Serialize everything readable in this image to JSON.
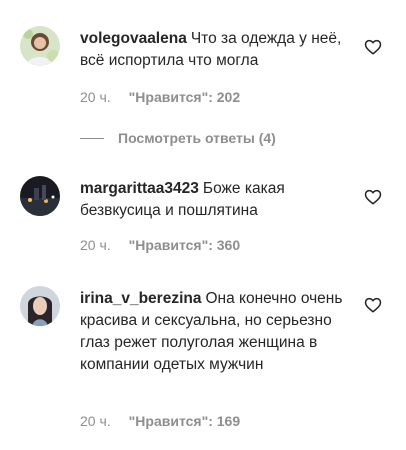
{
  "comments": [
    {
      "username": "volegovaalena",
      "text": "Что за одежда у неё, всё испортила что могла",
      "time": "20 ч.",
      "likes_label": "\"Нравится\": 202",
      "avatar_icon": "avatar-photo"
    },
    {
      "username": "margarittaa3423",
      "text": "Боже какая безвкусица и пошлятина",
      "time": "20 ч.",
      "likes_label": "\"Нравится\": 360",
      "avatar_icon": "avatar-photo"
    },
    {
      "username": "irina_v_berezina",
      "text": "Она конечно очень красива и сексуальна, но серьезно глаз режет полуголая женщина в компании одетых мужчин",
      "time": "20 ч.",
      "likes_label": "\"Нравится\": 169",
      "avatar_icon": "avatar-photo"
    }
  ],
  "view_replies_label": "Посмотреть ответы (4)",
  "icons": {
    "like": "heart-outline-icon"
  },
  "colors": {
    "text": "#262626",
    "secondary": "#8e8e8e",
    "background": "#ffffff"
  }
}
